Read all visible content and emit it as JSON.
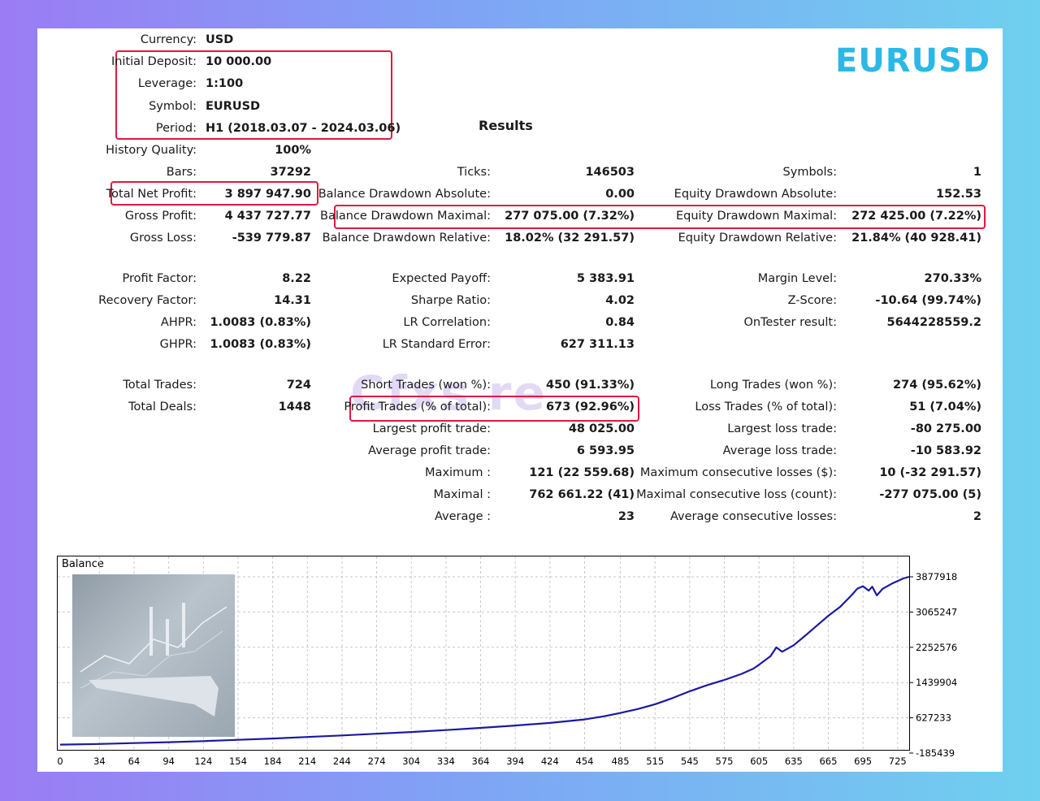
{
  "header": {
    "symbol_heading": "EURUSD",
    "results_title": "Results",
    "watermark": "Cfxs re"
  },
  "settings": [
    {
      "label": "Currency:",
      "value": "USD"
    },
    {
      "label": "Initial Deposit:",
      "value": "10 000.00"
    },
    {
      "label": "Leverage:",
      "value": "1:100"
    },
    {
      "label": "Symbol:",
      "value": "EURUSD"
    },
    {
      "label": "Period:",
      "value": "H1 (2018.03.07 - 2024.03.06)"
    },
    {
      "label": "History Quality:",
      "value": "100%"
    }
  ],
  "col1": [
    {
      "label": "Bars:",
      "value": "37292"
    },
    {
      "label": "Total Net Profit:",
      "value": "3 897 947.90"
    },
    {
      "label": "Gross Profit:",
      "value": "4 437 727.77"
    },
    {
      "label": "Gross Loss:",
      "value": "-539 779.87"
    },
    {
      "label": "Profit Factor:",
      "value": "8.22"
    },
    {
      "label": "Recovery Factor:",
      "value": "14.31"
    },
    {
      "label": "AHPR:",
      "value": "1.0083 (0.83%)"
    },
    {
      "label": "GHPR:",
      "value": "1.0083 (0.83%)"
    },
    {
      "label": "Total Trades:",
      "value": "724"
    },
    {
      "label": "Total Deals:",
      "value": "1448"
    }
  ],
  "col2": [
    {
      "label": "Ticks:",
      "value": "146503"
    },
    {
      "label": "Balance Drawdown Absolute:",
      "value": "0.00"
    },
    {
      "label": "Balance Drawdown Maximal:",
      "value": "277 075.00 (7.32%)"
    },
    {
      "label": "Balance Drawdown Relative:",
      "value": "18.02% (32 291.57)"
    },
    {
      "label": "Expected Payoff:",
      "value": "5 383.91"
    },
    {
      "label": "Sharpe Ratio:",
      "value": "4.02"
    },
    {
      "label": "LR Correlation:",
      "value": "0.84"
    },
    {
      "label": "LR Standard Error:",
      "value": "627 311.13"
    },
    {
      "label": "Short Trades (won %):",
      "value": "450 (91.33%)"
    },
    {
      "label": "Profit Trades (% of total):",
      "value": "673 (92.96%)"
    },
    {
      "label": "Largest profit trade:",
      "value": "48 025.00"
    },
    {
      "label": "Average profit trade:",
      "value": "6 593.95"
    },
    {
      "label": "Maximum :",
      "value": "121 (22 559.68)"
    },
    {
      "label": "Maximal :",
      "value": "762 661.22 (41)"
    },
    {
      "label": "Average :",
      "value": "23"
    }
  ],
  "col3": [
    {
      "label": "Symbols:",
      "value": "1"
    },
    {
      "label": "Equity Drawdown Absolute:",
      "value": "152.53"
    },
    {
      "label": "Equity Drawdown Maximal:",
      "value": "272 425.00 (7.22%)"
    },
    {
      "label": "Equity Drawdown Relative:",
      "value": "21.84% (40 928.41)"
    },
    {
      "label": "Margin Level:",
      "value": "270.33%"
    },
    {
      "label": "Z-Score:",
      "value": "-10.64 (99.74%)"
    },
    {
      "label": "OnTester result:",
      "value": "5644228559.2"
    },
    {
      "label": "Long Trades (won %):",
      "value": "274 (95.62%)"
    },
    {
      "label": "Loss Trades (% of total):",
      "value": "51 (7.04%)"
    },
    {
      "label": "Largest loss trade:",
      "value": "-80 275.00"
    },
    {
      "label": "Average loss trade:",
      "value": "-10 583.92"
    },
    {
      "label": "Maximum consecutive losses ($):",
      "value": "10 (-32 291.57)"
    },
    {
      "label": "Maximal consecutive loss (count):",
      "value": "-277 075.00 (5)"
    },
    {
      "label": "Average consecutive losses:",
      "value": "2"
    }
  ],
  "chart_data": {
    "type": "line",
    "title": "Balance",
    "x_ticks": [
      "0",
      "34",
      "64",
      "94",
      "124",
      "154",
      "184",
      "214",
      "244",
      "274",
      "304",
      "334",
      "364",
      "394",
      "424",
      "454",
      "485",
      "515",
      "545",
      "575",
      "605",
      "635",
      "665",
      "695",
      "725"
    ],
    "y_ticks": [
      "3877918",
      "3065247",
      "2252576",
      "1439904",
      "627233",
      "-185439"
    ],
    "ylim": [
      -185439,
      3877918
    ],
    "xlim": [
      0,
      735
    ],
    "grid": true,
    "series": [
      {
        "color": "#1a1aa0",
        "x": [
          0,
          34,
          64,
          94,
          124,
          154,
          184,
          214,
          244,
          274,
          304,
          334,
          364,
          394,
          424,
          454,
          470,
          485,
          500,
          515,
          530,
          545,
          560,
          575,
          590,
          600,
          605,
          615,
          620,
          625,
          635,
          645,
          655,
          665,
          675,
          685,
          690,
          695,
          700,
          703,
          707,
          712,
          720,
          730,
          735
        ],
        "y": [
          10000,
          25000,
          45000,
          65000,
          90000,
          120000,
          150000,
          185000,
          220000,
          260000,
          300000,
          345000,
          395000,
          450000,
          510000,
          590000,
          660000,
          740000,
          830000,
          940000,
          1080000,
          1240000,
          1380000,
          1500000,
          1640000,
          1760000,
          1850000,
          2050000,
          2250000,
          2150000,
          2300000,
          2520000,
          2750000,
          2980000,
          3180000,
          3450000,
          3600000,
          3660000,
          3560000,
          3650000,
          3450000,
          3600000,
          3720000,
          3840000,
          3877918
        ]
      }
    ]
  }
}
